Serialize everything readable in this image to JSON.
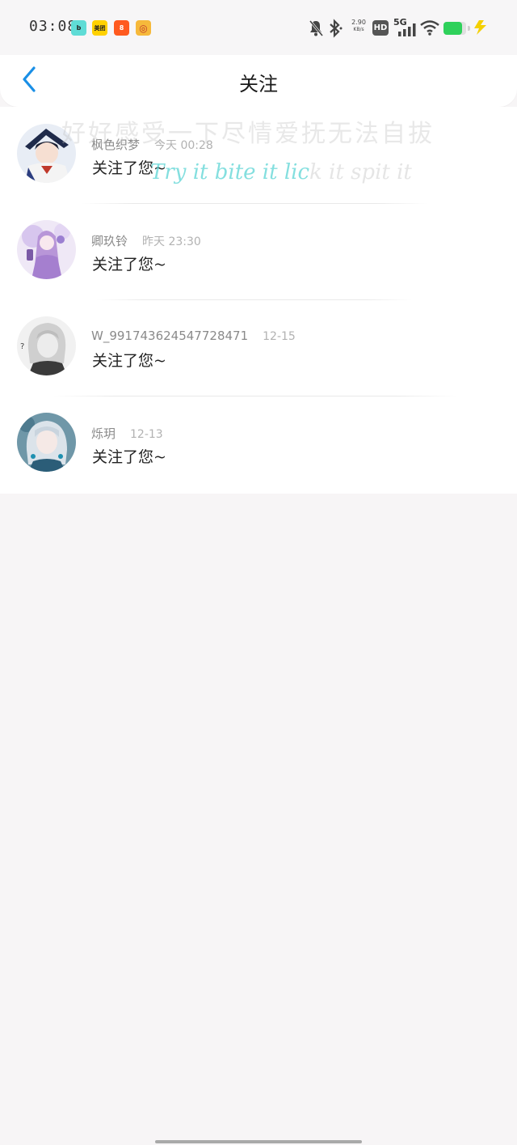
{
  "status_bar": {
    "time": "03:08",
    "apps": [
      {
        "name": "bilibili-like-app",
        "label": "b",
        "color": "#5fdcd6"
      },
      {
        "name": "meituan",
        "label": "美团",
        "color": "#ffd100"
      },
      {
        "name": "kuaishou",
        "label": "8",
        "color": "#ff5a1f"
      },
      {
        "name": "coin-app",
        "label": "◎",
        "color": "#f6b93b"
      }
    ],
    "net_speed_value": "2.90",
    "net_speed_unit": "KB/s",
    "hd_label": "HD",
    "network_label": "5G",
    "battery_level": 0.82,
    "battery_color": "#2fd15b"
  },
  "nav": {
    "title": "关注"
  },
  "watermark": {
    "line1": "好好感受一下尽情爱抚无法自拔",
    "line2_highlight": "Try it bite it lic",
    "line2_rest": "k it spit it"
  },
  "followers": [
    {
      "name": "枫色织梦",
      "time": "今天 00:28",
      "message": "关注了您~"
    },
    {
      "name": "卿玖铃",
      "time": "昨天 23:30",
      "message": "关注了您~"
    },
    {
      "name": "W_991743624547728471",
      "time": "12-15",
      "message": "关注了您~"
    },
    {
      "name": "烁玥",
      "time": "12-13",
      "message": "关注了您~"
    }
  ],
  "colors": {
    "accent": "#1a8fe6",
    "page_bg": "#f7f5f6",
    "card_bg": "#ffffff"
  }
}
